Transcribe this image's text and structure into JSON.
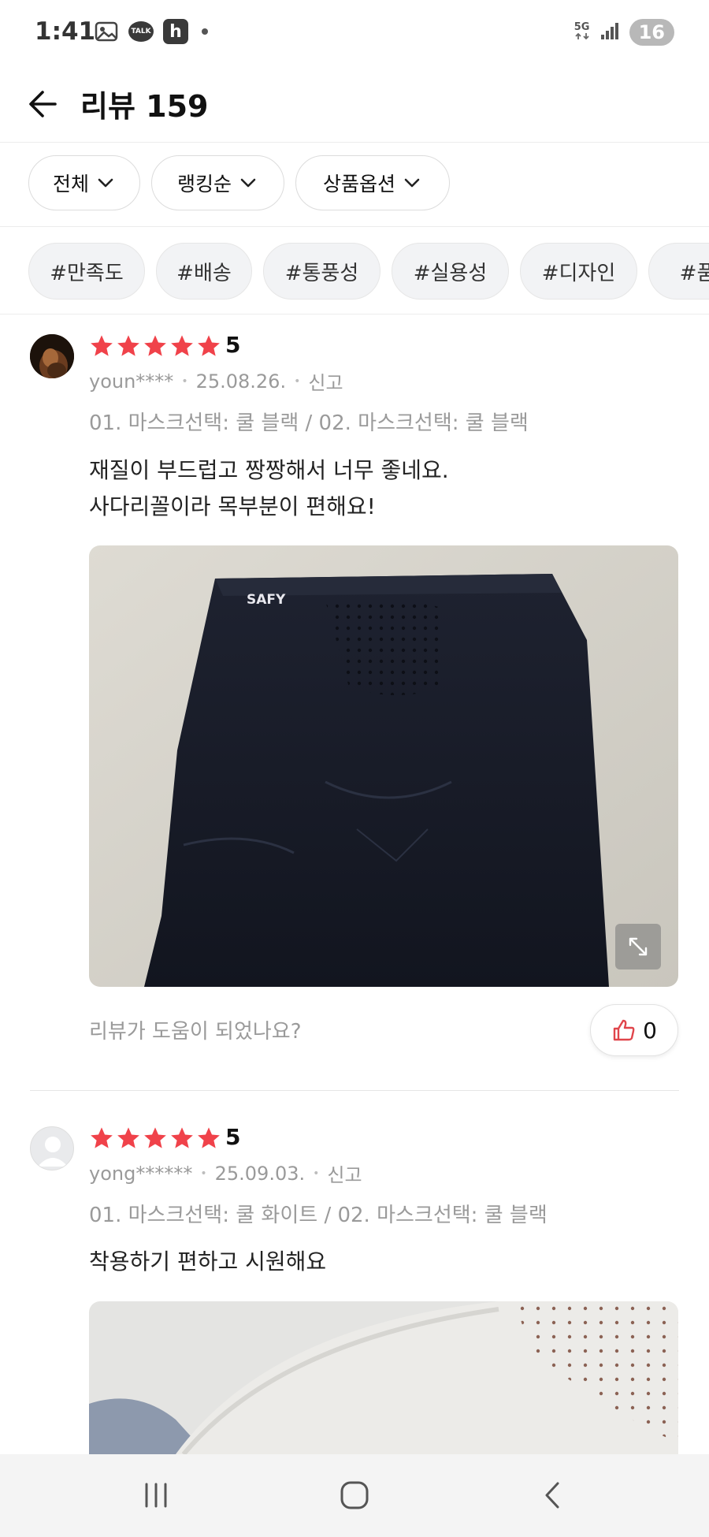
{
  "status_bar": {
    "time": "1:41",
    "network": "5G",
    "battery": "16",
    "talk_label": "TALK",
    "h_label": "h"
  },
  "header": {
    "title": "리뷰 159"
  },
  "filters": [
    {
      "label": "전체"
    },
    {
      "label": "랭킹순"
    },
    {
      "label": "상품옵션"
    }
  ],
  "tags": [
    "#만족도",
    "#배송",
    "#통풍성",
    "#실용성",
    "#디자인",
    "#품질"
  ],
  "reviews": [
    {
      "rating": "5",
      "user": "youn****",
      "date": "25.08.26.",
      "report": "신고",
      "options": "01. 마스크선택: 쿨 블랙 / 02. 마스크선택: 쿨 블랙",
      "text_lines": [
        "재질이 부드럽고 짱짱해서 너무 좋네요.",
        "사다리꼴이라 목부분이 편해요!"
      ],
      "photo_brand": "SAFY",
      "helpful_prompt": "리뷰가 도움이 되었나요?",
      "likes": "0"
    },
    {
      "rating": "5",
      "user": "yong******",
      "date": "25.09.03.",
      "report": "신고",
      "options": "01. 마스크선택: 쿨 화이트 / 02. 마스크선택: 쿨 블랙",
      "text_lines": [
        "착용하기 편하고 시원해요"
      ]
    }
  ],
  "colors": {
    "star": "#f0424a",
    "like_icon": "#e0454b",
    "muted_text": "#9a9a9a"
  }
}
